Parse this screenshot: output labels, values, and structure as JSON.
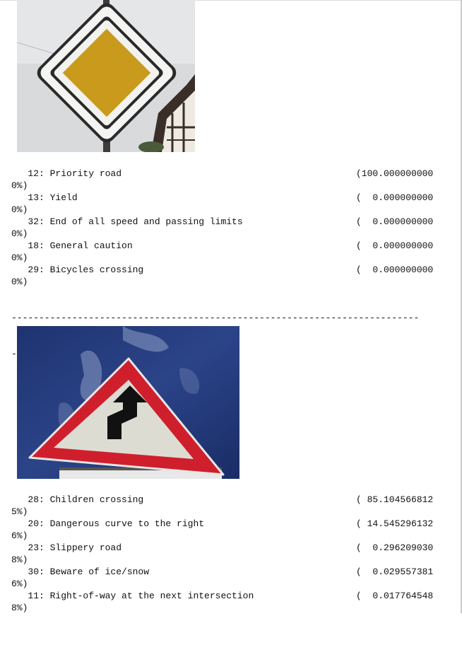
{
  "results": [
    {
      "image_icon": "priority-road-sign",
      "predictions": [
        {
          "label": "   12: Priority road",
          "value": "(100.000000000",
          "wrap": "0%)"
        },
        {
          "label": "   13: Yield",
          "value": "(  0.000000000",
          "wrap": "0%)"
        },
        {
          "label": "   32: End of all speed and passing limits",
          "value": "(  0.000000000",
          "wrap": "0%)"
        },
        {
          "label": "   18: General caution",
          "value": "(  0.000000000",
          "wrap": "0%)"
        },
        {
          "label": "   29: Bicycles crossing",
          "value": "(  0.000000000",
          "wrap": "0%)"
        }
      ]
    },
    {
      "image_icon": "double-curve-warning-sign",
      "predictions": [
        {
          "label": "   28: Children crossing",
          "value": "( 85.104566812",
          "wrap": "5%)"
        },
        {
          "label": "   20: Dangerous curve to the right",
          "value": "( 14.545296132",
          "wrap": "6%)"
        },
        {
          "label": "   23: Slippery road",
          "value": "(  0.296209030",
          "wrap": "8%)"
        },
        {
          "label": "   30: Beware of ice/snow",
          "value": "(  0.029557381",
          "wrap": "6%)"
        },
        {
          "label": "   11: Right-of-way at the next intersection",
          "value": "(  0.017764548",
          "wrap": "8%)"
        }
      ]
    }
  ],
  "separator_line1": "--------------------------------------------------------------------------",
  "separator_line2": "-------",
  "colors": {
    "sign_yellow": "#c99a1c",
    "sign_red": "#d0202e",
    "sky_blue": "#243a7a"
  }
}
